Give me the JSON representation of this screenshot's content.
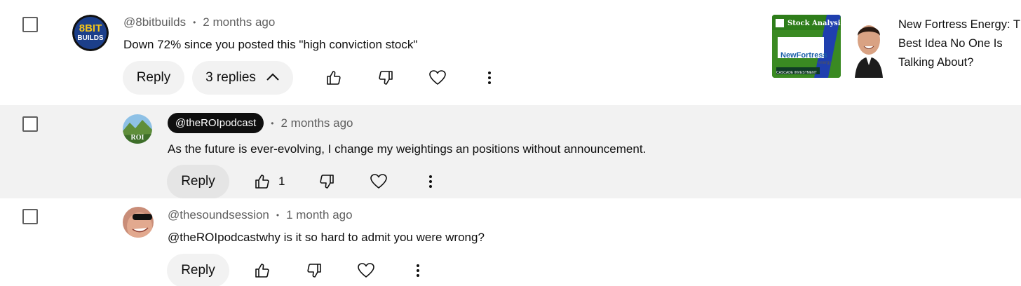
{
  "comments": [
    {
      "author": "@8bitbuilds",
      "time": "2 months ago",
      "text": "Down 72% since you posted this \"high conviction stock\"",
      "reply_label": "Reply",
      "replies_label": "3 replies",
      "avatar_text": "8BIT BUILDS"
    },
    {
      "author": "@theROIpodcast",
      "time": "2 months ago",
      "text": "As the future is ever-evolving, I change my weightings an positions without announcement.",
      "reply_label": "Reply",
      "like_count": "1",
      "avatar_text": "ROI"
    },
    {
      "author": "@thesoundsession",
      "time": "1 month ago",
      "text": "@theROIpodcastwhy is it so hard to admit you were wrong?",
      "reply_label": "Reply"
    }
  ],
  "video": {
    "title": "New Fortress Energy: The Best Idea No One Is Talking About?",
    "thumbnail_label": "Stock Analysis",
    "thumbnail_brand": "NewFortress",
    "thumbnail_brand_sub": "energy",
    "thumbnail_footer": "CASCADE INVESTMENT"
  },
  "icons": {
    "like": "thumb-up-icon",
    "dislike": "thumb-down-icon",
    "heart": "heart-icon",
    "more": "more-vert-icon",
    "chevron": "chevron-up-icon"
  },
  "colors": {
    "highlight_bg": "#f2f2f2",
    "owner_chip": "#0f0f0f",
    "meta_text": "#606060"
  }
}
